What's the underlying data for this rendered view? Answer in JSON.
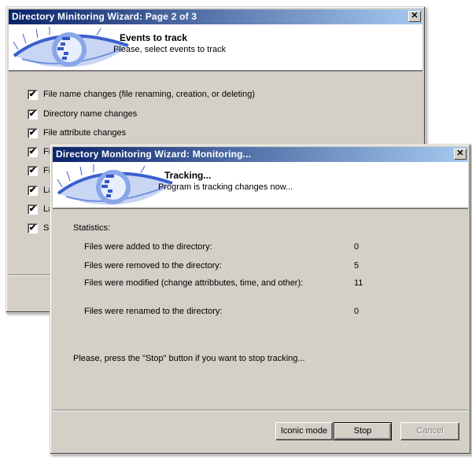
{
  "back_window": {
    "title": "Directory Minitoring Wizard: Page 2 of 3",
    "header_title": "Events to track",
    "header_subtitle": "Please, select events to track",
    "events": [
      {
        "label": "File name changes (file renaming, creation, or deleting)",
        "checked": true
      },
      {
        "label": "Directory name changes",
        "checked": true
      },
      {
        "label": "File attribute changes",
        "checked": true
      },
      {
        "label": "Fil",
        "checked": true
      },
      {
        "label": "Fil",
        "checked": true
      },
      {
        "label": "La",
        "checked": true
      },
      {
        "label": "La",
        "checked": true
      },
      {
        "label": "Se",
        "checked": true
      }
    ]
  },
  "front_window": {
    "title": "Directory Monitoring Wizard: Monitoring...",
    "header_title": "Tracking...",
    "header_subtitle": "Program is tracking changes now...",
    "statistics_label": "Statistics:",
    "stats": [
      {
        "label": "Files were added to the directory:",
        "value": "0"
      },
      {
        "label": "Files were removed to the directory:",
        "value": "5"
      },
      {
        "label": "Files were modified (change attribbutes, time, and other):",
        "value": "11"
      },
      {
        "label": "Files were renamed to the directory:",
        "value": "0"
      }
    ],
    "hint": "Please, press the \"Stop\" button if you want to stop tracking...",
    "buttons": {
      "iconic": "Iconic mode",
      "stop": "Stop",
      "cancel": "Cancel"
    }
  },
  "close_glyph": "✕",
  "check_glyph": "✔"
}
